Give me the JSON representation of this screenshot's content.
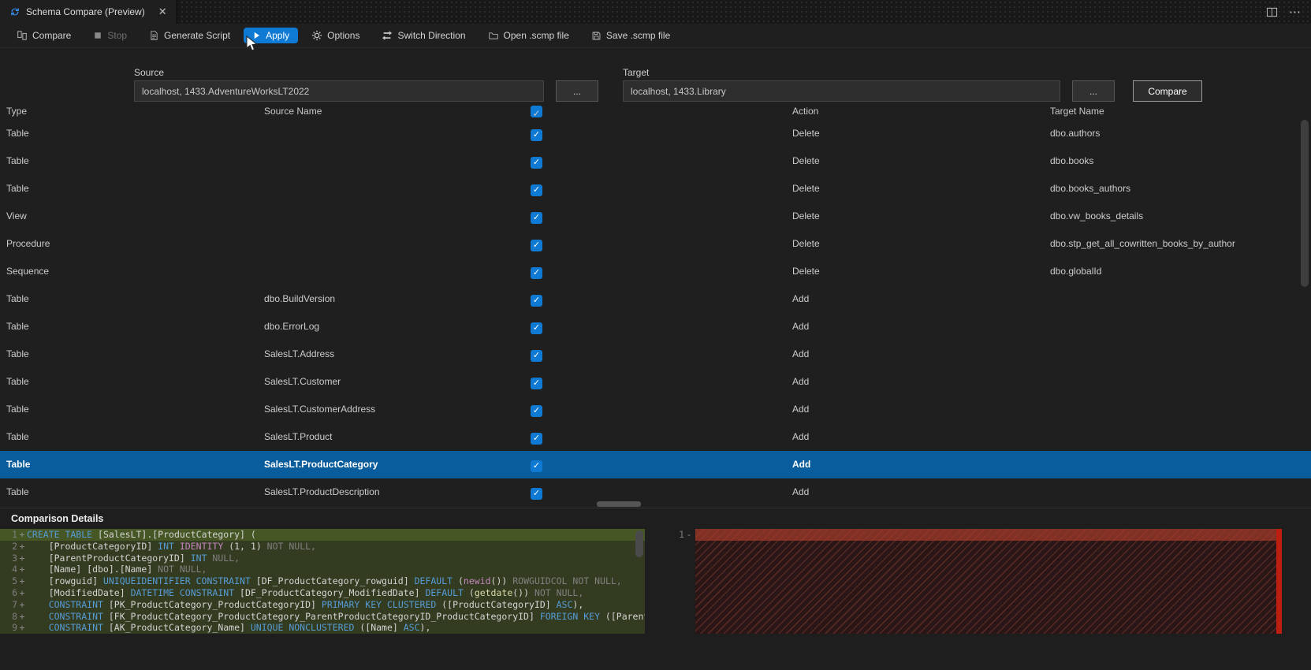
{
  "colors": {
    "accent": "#0e7ad3",
    "selected_row": "#0a5d9c",
    "diff_add_bg": "rgba(106,135,40,0.28)",
    "diff_add_current_bg": "rgba(122,156,46,0.45)",
    "diff_del_mark": "#bc1f10"
  },
  "icons": {
    "check": "✓",
    "close": "✕",
    "more": "⋯"
  },
  "tab_bar": {
    "tab_title": "Schema Compare (Preview)"
  },
  "toolbar": {
    "items": [
      {
        "label": "Compare",
        "icon": "compare-icon"
      },
      {
        "label": "Stop",
        "icon": "stop-icon",
        "disabled": true
      },
      {
        "label": "Generate Script",
        "icon": "script-icon"
      },
      {
        "label": "Apply",
        "icon": "play-icon",
        "active": true
      },
      {
        "label": "Options",
        "icon": "gear-icon"
      },
      {
        "label": "Switch Direction",
        "icon": "switch-icon"
      },
      {
        "label": "Open .scmp file",
        "icon": "open-file-icon"
      },
      {
        "label": "Save .scmp file",
        "icon": "save-file-icon"
      }
    ]
  },
  "connections": {
    "source_label": "Source",
    "source_value": "localhost, 1433.AdventureWorksLT2022",
    "target_label": "Target",
    "target_value": "localhost, 1433.Library",
    "browse_label": "...",
    "compare_button_label": "Compare"
  },
  "grid": {
    "headers": {
      "type": "Type",
      "source": "Source Name",
      "action": "Action",
      "target": "Target Name"
    },
    "header_checked": true,
    "rows": [
      {
        "type": "Table",
        "source": "",
        "checked": true,
        "action": "Delete",
        "target": "dbo.authors"
      },
      {
        "type": "Table",
        "source": "",
        "checked": true,
        "action": "Delete",
        "target": "dbo.books"
      },
      {
        "type": "Table",
        "source": "",
        "checked": true,
        "action": "Delete",
        "target": "dbo.books_authors"
      },
      {
        "type": "View",
        "source": "",
        "checked": true,
        "action": "Delete",
        "target": "dbo.vw_books_details"
      },
      {
        "type": "Procedure",
        "source": "",
        "checked": true,
        "action": "Delete",
        "target": "dbo.stp_get_all_cowritten_books_by_author"
      },
      {
        "type": "Sequence",
        "source": "",
        "checked": true,
        "action": "Delete",
        "target": "dbo.globalId"
      },
      {
        "type": "Table",
        "source": "dbo.BuildVersion",
        "checked": true,
        "action": "Add",
        "target": ""
      },
      {
        "type": "Table",
        "source": "dbo.ErrorLog",
        "checked": true,
        "action": "Add",
        "target": ""
      },
      {
        "type": "Table",
        "source": "SalesLT.Address",
        "checked": true,
        "action": "Add",
        "target": ""
      },
      {
        "type": "Table",
        "source": "SalesLT.Customer",
        "checked": true,
        "action": "Add",
        "target": ""
      },
      {
        "type": "Table",
        "source": "SalesLT.CustomerAddress",
        "checked": true,
        "action": "Add",
        "target": ""
      },
      {
        "type": "Table",
        "source": "SalesLT.Product",
        "checked": true,
        "action": "Add",
        "target": ""
      },
      {
        "type": "Table",
        "source": "SalesLT.ProductCategory",
        "checked": true,
        "action": "Add",
        "target": "",
        "selected": true
      },
      {
        "type": "Table",
        "source": "SalesLT.ProductDescription",
        "checked": true,
        "action": "Add",
        "target": ""
      }
    ]
  },
  "details": {
    "title": "Comparison Details",
    "left_lines": [
      {
        "num": "1",
        "sign": "+",
        "current": true,
        "tokens": [
          [
            "kw",
            "CREATE TABLE"
          ],
          [
            "pln",
            " [SalesLT].[ProductCategory] ("
          ]
        ]
      },
      {
        "num": "2",
        "sign": "+",
        "tokens": [
          [
            "pln",
            "    [ProductCategoryID] "
          ],
          [
            "kw",
            "INT"
          ],
          [
            "mag",
            " IDENTITY "
          ],
          [
            "pln",
            "(1, 1) "
          ],
          [
            "dim",
            "NOT NULL,"
          ]
        ]
      },
      {
        "num": "3",
        "sign": "+",
        "tokens": [
          [
            "pln",
            "    [ParentProductCategoryID] "
          ],
          [
            "kw",
            "INT"
          ],
          [
            "dim",
            " NULL,"
          ]
        ]
      },
      {
        "num": "4",
        "sign": "+",
        "tokens": [
          [
            "pln",
            "    [Name] [dbo].[Name] "
          ],
          [
            "dim",
            "NOT NULL,"
          ]
        ]
      },
      {
        "num": "5",
        "sign": "+",
        "tokens": [
          [
            "pln",
            "    [rowguid] "
          ],
          [
            "kw",
            "UNIQUEIDENTIFIER CONSTRAINT"
          ],
          [
            "pln",
            " [DF_ProductCategory_rowguid] "
          ],
          [
            "kw",
            "DEFAULT"
          ],
          [
            "pln",
            " ("
          ],
          [
            "mag",
            "newid"
          ],
          [
            "pln",
            "()) "
          ],
          [
            "dim",
            "ROWGUIDCOL NOT NULL,"
          ]
        ]
      },
      {
        "num": "6",
        "sign": "+",
        "tokens": [
          [
            "pln",
            "    [ModifiedDate] "
          ],
          [
            "kw",
            "DATETIME CONSTRAINT"
          ],
          [
            "pln",
            " [DF_ProductCategory_ModifiedDate] "
          ],
          [
            "kw",
            "DEFAULT"
          ],
          [
            "pln",
            " ("
          ],
          [
            "fn",
            "getdate"
          ],
          [
            "pln",
            "()) "
          ],
          [
            "dim",
            "NOT NULL,"
          ]
        ]
      },
      {
        "num": "7",
        "sign": "+",
        "tokens": [
          [
            "kw",
            "    CONSTRAINT"
          ],
          [
            "pln",
            " [PK_ProductCategory_ProductCategoryID] "
          ],
          [
            "kw",
            "PRIMARY KEY CLUSTERED"
          ],
          [
            "pln",
            " ([ProductCategoryID] "
          ],
          [
            "kw",
            "ASC"
          ],
          [
            "pln",
            "),"
          ]
        ]
      },
      {
        "num": "8",
        "sign": "+",
        "tokens": [
          [
            "kw",
            "    CONSTRAINT"
          ],
          [
            "pln",
            " [FK_ProductCategory_ProductCategory_ParentProductCategoryID_ProductCategoryID] "
          ],
          [
            "kw",
            "FOREIGN KEY"
          ],
          [
            "pln",
            " ([ParentProductCatego"
          ]
        ]
      },
      {
        "num": "9",
        "sign": "+",
        "tokens": [
          [
            "kw",
            "    CONSTRAINT"
          ],
          [
            "pln",
            " [AK_ProductCategory_Name] "
          ],
          [
            "kw",
            "UNIQUE NONCLUSTERED"
          ],
          [
            "pln",
            " ([Name] "
          ],
          [
            "kw",
            "ASC"
          ],
          [
            "pln",
            "),"
          ]
        ]
      }
    ],
    "right_lines": [
      {
        "num": "1",
        "sign": "-",
        "tokens": []
      }
    ]
  }
}
